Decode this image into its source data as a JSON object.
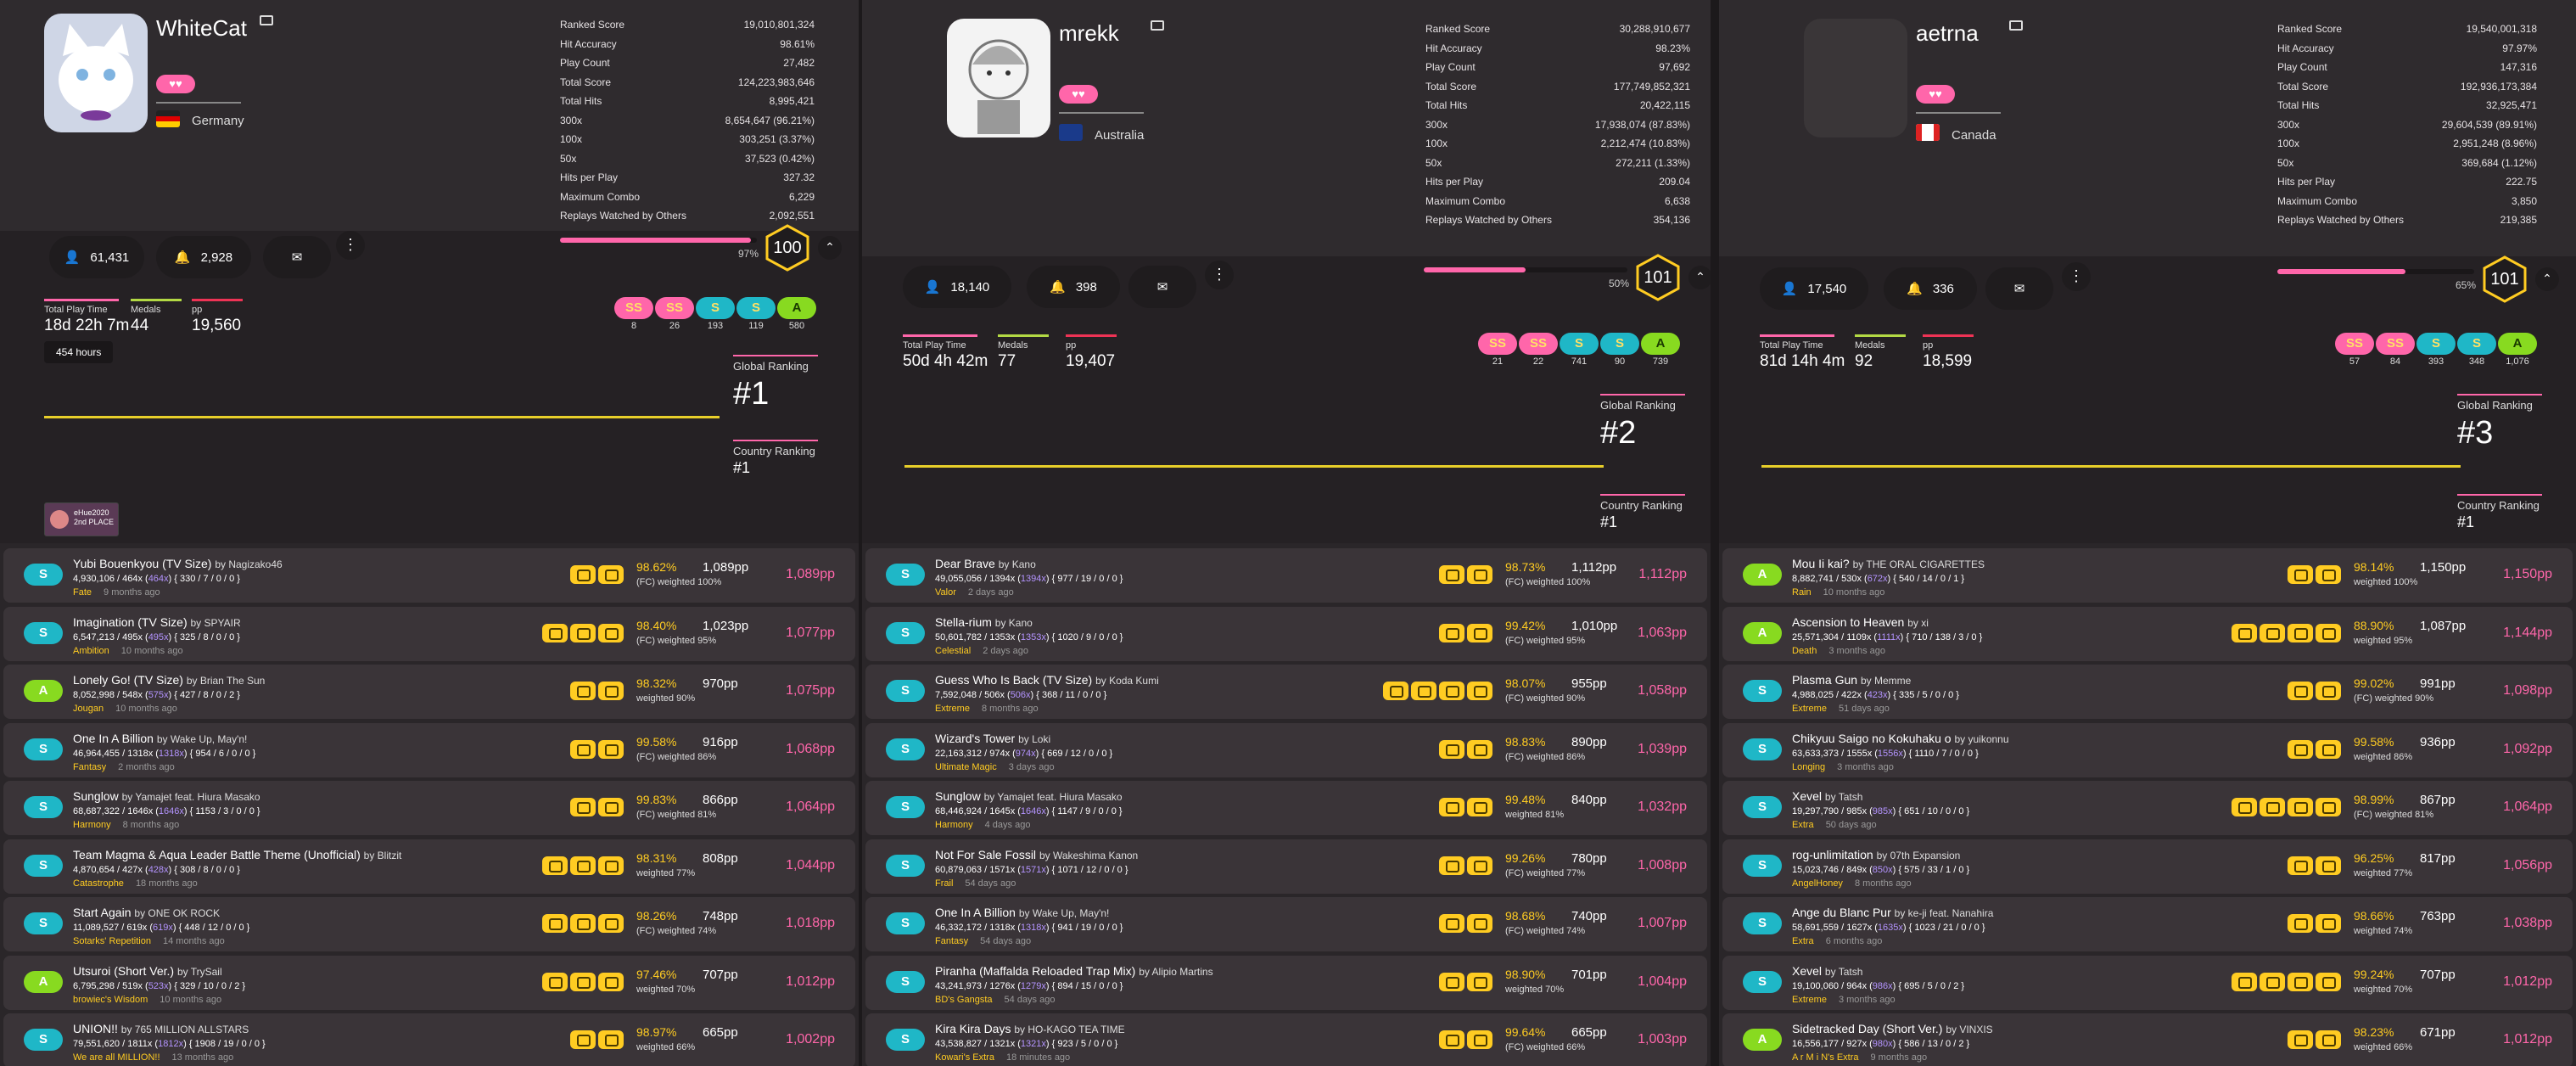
{
  "colors": {
    "pink": "#ff66aa",
    "gold": "#ffcc22",
    "purple_ext": "#b494ff",
    "ss_grade": "#ff66aa",
    "s_grade": "#1fb7c7",
    "a_grade": "#88da20"
  },
  "panels": [
    {
      "username": "WhiteCat",
      "country": "Germany",
      "stats": [
        {
          "label": "Ranked Score",
          "value": "19,010,801,324"
        },
        {
          "label": "Hit Accuracy",
          "value": "98.61%"
        },
        {
          "label": "Play Count",
          "value": "27,482"
        },
        {
          "label": "Total Score",
          "value": "124,223,983,646"
        },
        {
          "label": "Total Hits",
          "value": "8,995,421"
        },
        {
          "label": "300x",
          "value": "8,654,647 (96.21%)"
        },
        {
          "label": "100x",
          "value": "303,251 (3.37%)"
        },
        {
          "label": "50x",
          "value": "37,523 (0.42%)"
        },
        {
          "label": "Hits per Play",
          "value": "327.32"
        },
        {
          "label": "Maximum Combo",
          "value": "6,229"
        },
        {
          "label": "Replays Watched by Others",
          "value": "2,092,551"
        }
      ],
      "followers": "61,431",
      "subscribers": "2,928",
      "level_progress_label": "97%",
      "level_progress": 0.97,
      "level": "100",
      "play_time_label": "Total Play Time",
      "play_time": "18d 22h 7m",
      "medals_label": "Medals",
      "medals": "44",
      "pp_label": "pp",
      "pp": "19,560",
      "tooltip": "454 hours",
      "grades": [
        {
          "grade": "SS",
          "count": "8"
        },
        {
          "grade": "SS",
          "count": "26"
        },
        {
          "grade": "S",
          "count": "193"
        },
        {
          "grade": "S",
          "count": "119"
        },
        {
          "grade": "A",
          "count": "580"
        }
      ],
      "global_ranking_label": "Global Ranking",
      "global_rank": "#1",
      "country_ranking_label": "Country Ranking",
      "country_rank": "#1",
      "badge_text": "eHue2020 2nd PLACE",
      "plays": [
        {
          "rank": "S",
          "title": "Yubi Bouenkyou (TV Size)",
          "by": "by Nagizako46",
          "meta_a": "4,930,106 / 464x (",
          "meta_b": "464x",
          "meta_c": ") { 330 / 7 / 0 / 0 }",
          "diff": "Fate",
          "ago": "9 months ago",
          "mods": 2,
          "acc": "98.62%",
          "wpp": "1,089pp",
          "weight": "(FC) weighted 100%",
          "pp": "1,089pp"
        },
        {
          "rank": "S",
          "title": "Imagination (TV Size)",
          "by": "by SPYAIR",
          "meta_a": "6,547,213 / 495x (",
          "meta_b": "495x",
          "meta_c": ") { 325 / 8 / 0 / 0 }",
          "diff": "Ambition",
          "ago": "10 months ago",
          "mods": 3,
          "acc": "98.40%",
          "wpp": "1,023pp",
          "weight": "(FC) weighted 95%",
          "pp": "1,077pp"
        },
        {
          "rank": "A",
          "title": "Lonely Go! (TV Size)",
          "by": "by Brian The Sun",
          "meta_a": "8,052,998 / 548x (",
          "meta_b": "575x",
          "meta_c": ") { 427 / 8 / 0 / 2 }",
          "diff": "Jougan",
          "ago": "10 months ago",
          "mods": 2,
          "acc": "98.32%",
          "wpp": "970pp",
          "weight": "weighted 90%",
          "pp": "1,075pp"
        },
        {
          "rank": "S",
          "title": "One In A Billion",
          "by": "by Wake Up, May'n!",
          "meta_a": "46,964,455 / 1318x (",
          "meta_b": "1318x",
          "meta_c": ") { 954 / 6 / 0 / 0 }",
          "diff": "Fantasy",
          "ago": "2 months ago",
          "mods": 2,
          "acc": "99.58%",
          "wpp": "916pp",
          "weight": "(FC) weighted 86%",
          "pp": "1,068pp"
        },
        {
          "rank": "S",
          "title": "Sunglow",
          "by": "by Yamajet feat. Hiura Masako",
          "meta_a": "68,687,322 / 1646x (",
          "meta_b": "1646x",
          "meta_c": ") { 1153 / 3 / 0 / 0 }",
          "diff": "Harmony",
          "ago": "8 months ago",
          "mods": 2,
          "acc": "99.83%",
          "wpp": "866pp",
          "weight": "(FC) weighted 81%",
          "pp": "1,064pp"
        },
        {
          "rank": "S",
          "title": "Team Magma & Aqua Leader Battle Theme (Unofficial)",
          "by": "by Blitzit",
          "meta_a": "4,870,654 / 427x (",
          "meta_b": "428x",
          "meta_c": ") { 308 / 8 / 0 / 0 }",
          "diff": "Catastrophe",
          "ago": "18 months ago",
          "mods": 3,
          "acc": "98.31%",
          "wpp": "808pp",
          "weight": "weighted 77%",
          "pp": "1,044pp"
        },
        {
          "rank": "S",
          "title": "Start Again",
          "by": "by ONE OK ROCK",
          "meta_a": "11,089,527 / 619x (",
          "meta_b": "619x",
          "meta_c": ") { 448 / 12 / 0 / 0 }",
          "diff": "Sotarks' Repetition",
          "ago": "14 months ago",
          "mods": 3,
          "acc": "98.26%",
          "wpp": "748pp",
          "weight": "(FC) weighted 74%",
          "pp": "1,018pp"
        },
        {
          "rank": "A",
          "title": "Utsuroi (Short Ver.)",
          "by": "by TrySail",
          "meta_a": "6,795,298 / 519x (",
          "meta_b": "523x",
          "meta_c": ") { 329 / 10 / 0 / 2 }",
          "diff": "browiec's Wisdom",
          "ago": "10 months ago",
          "mods": 3,
          "acc": "97.46%",
          "wpp": "707pp",
          "weight": "weighted 70%",
          "pp": "1,012pp"
        },
        {
          "rank": "S",
          "title": "UNION!!",
          "by": "by 765 MILLION ALLSTARS",
          "meta_a": "79,551,620 / 1811x (",
          "meta_b": "1812x",
          "meta_c": ") { 1908 / 19 / 0 / 0 }",
          "diff": "We are all MILLION!!",
          "ago": "13 months ago",
          "mods": 2,
          "acc": "98.97%",
          "wpp": "665pp",
          "weight": "weighted 66%",
          "pp": "1,002pp"
        }
      ]
    },
    {
      "username": "mrekk",
      "country": "Australia",
      "stats": [
        {
          "label": "Ranked Score",
          "value": "30,288,910,677"
        },
        {
          "label": "Hit Accuracy",
          "value": "98.23%"
        },
        {
          "label": "Play Count",
          "value": "97,692"
        },
        {
          "label": "Total Score",
          "value": "177,749,852,321"
        },
        {
          "label": "Total Hits",
          "value": "20,422,115"
        },
        {
          "label": "300x",
          "value": "17,938,074 (87.83%)"
        },
        {
          "label": "100x",
          "value": "2,212,474 (10.83%)"
        },
        {
          "label": "50x",
          "value": "272,211 (1.33%)"
        },
        {
          "label": "Hits per Play",
          "value": "209.04"
        },
        {
          "label": "Maximum Combo",
          "value": "6,638"
        },
        {
          "label": "Replays Watched by Others",
          "value": "354,136"
        }
      ],
      "followers": "18,140",
      "subscribers": "398",
      "level_progress_label": "50%",
      "level_progress": 0.5,
      "level": "101",
      "play_time_label": "Total Play Time",
      "play_time": "50d 4h 42m",
      "medals_label": "Medals",
      "medals": "77",
      "pp_label": "pp",
      "pp": "19,407",
      "grades": [
        {
          "grade": "SS",
          "count": "21"
        },
        {
          "grade": "SS",
          "count": "22"
        },
        {
          "grade": "S",
          "count": "741"
        },
        {
          "grade": "S",
          "count": "90"
        },
        {
          "grade": "A",
          "count": "739"
        }
      ],
      "global_ranking_label": "Global Ranking",
      "global_rank": "#2",
      "country_ranking_label": "Country Ranking",
      "country_rank": "#1",
      "plays": [
        {
          "rank": "S",
          "title": "Dear Brave",
          "by": "by Kano",
          "meta_a": "49,055,056 / 1394x (",
          "meta_b": "1394x",
          "meta_c": ") { 977 / 19 / 0 / 0 }",
          "diff": "Valor",
          "ago": "2 days ago",
          "mods": 2,
          "acc": "98.73%",
          "wpp": "1,112pp",
          "weight": "(FC) weighted 100%",
          "pp": "1,112pp"
        },
        {
          "rank": "S",
          "title": "Stella-rium",
          "by": "by Kano",
          "meta_a": "50,601,782 / 1353x (",
          "meta_b": "1353x",
          "meta_c": ") { 1020 / 9 / 0 / 0 }",
          "diff": "Celestial",
          "ago": "2 days ago",
          "mods": 2,
          "acc": "99.42%",
          "wpp": "1,010pp",
          "weight": "(FC) weighted 95%",
          "pp": "1,063pp"
        },
        {
          "rank": "S",
          "title": "Guess Who Is Back (TV Size)",
          "by": "by Koda Kumi",
          "meta_a": "7,592,048 / 506x (",
          "meta_b": "506x",
          "meta_c": ") { 368 / 11 / 0 / 0 }",
          "diff": "Extreme",
          "ago": "8 months ago",
          "mods": 4,
          "acc": "98.07%",
          "wpp": "955pp",
          "weight": "(FC) weighted 90%",
          "pp": "1,058pp"
        },
        {
          "rank": "S",
          "title": "Wizard's Tower",
          "by": "by Loki",
          "meta_a": "22,163,312 / 974x (",
          "meta_b": "974x",
          "meta_c": ") { 669 / 12 / 0 / 0 }",
          "diff": "Ultimate Magic",
          "ago": "3 days ago",
          "mods": 2,
          "acc": "98.83%",
          "wpp": "890pp",
          "weight": "(FC) weighted 86%",
          "pp": "1,039pp"
        },
        {
          "rank": "S",
          "title": "Sunglow",
          "by": "by Yamajet feat. Hiura Masako",
          "meta_a": "68,446,924 / 1645x (",
          "meta_b": "1646x",
          "meta_c": ") { 1147 / 9 / 0 / 0 }",
          "diff": "Harmony",
          "ago": "4 days ago",
          "mods": 2,
          "acc": "99.48%",
          "wpp": "840pp",
          "weight": "weighted 81%",
          "pp": "1,032pp"
        },
        {
          "rank": "S",
          "title": "Not For Sale Fossil",
          "by": "by Wakeshima Kanon",
          "meta_a": "60,879,063 / 1571x (",
          "meta_b": "1571x",
          "meta_c": ") { 1071 / 12 / 0 / 0 }",
          "diff": "Frail",
          "ago": "54 days ago",
          "mods": 2,
          "acc": "99.26%",
          "wpp": "780pp",
          "weight": "(FC) weighted 77%",
          "pp": "1,008pp"
        },
        {
          "rank": "S",
          "title": "One In A Billion",
          "by": "by Wake Up, May'n!",
          "meta_a": "46,332,172 / 1318x (",
          "meta_b": "1318x",
          "meta_c": ") { 941 / 19 / 0 / 0 }",
          "diff": "Fantasy",
          "ago": "54 days ago",
          "mods": 2,
          "acc": "98.68%",
          "wpp": "740pp",
          "weight": "(FC) weighted 74%",
          "pp": "1,007pp"
        },
        {
          "rank": "S",
          "title": "Piranha (Maffalda Reloaded Trap Mix)",
          "by": "by Alipio Martins",
          "meta_a": "43,241,973 / 1276x (",
          "meta_b": "1279x",
          "meta_c": ") { 894 / 15 / 0 / 0 }",
          "diff": "BD's Gangsta",
          "ago": "54 days ago",
          "mods": 2,
          "acc": "98.90%",
          "wpp": "701pp",
          "weight": "weighted 70%",
          "pp": "1,004pp"
        },
        {
          "rank": "S",
          "title": "Kira Kira Days",
          "by": "by HO-KAGO TEA TIME",
          "meta_a": "43,538,827 / 1321x (",
          "meta_b": "1321x",
          "meta_c": ") { 923 / 5 / 0 / 0 }",
          "diff": "Kowari's Extra",
          "ago": "18 minutes ago",
          "mods": 2,
          "acc": "99.64%",
          "wpp": "665pp",
          "weight": "(FC) weighted 66%",
          "pp": "1,003pp"
        }
      ]
    },
    {
      "username": "aetrna",
      "country": "Canada",
      "stats": [
        {
          "label": "Ranked Score",
          "value": "19,540,001,318"
        },
        {
          "label": "Hit Accuracy",
          "value": "97.97%"
        },
        {
          "label": "Play Count",
          "value": "147,316"
        },
        {
          "label": "Total Score",
          "value": "192,936,173,384"
        },
        {
          "label": "Total Hits",
          "value": "32,925,471"
        },
        {
          "label": "300x",
          "value": "29,604,539 (89.91%)"
        },
        {
          "label": "100x",
          "value": "2,951,248 (8.96%)"
        },
        {
          "label": "50x",
          "value": "369,684 (1.12%)"
        },
        {
          "label": "Hits per Play",
          "value": "222.75"
        },
        {
          "label": "Maximum Combo",
          "value": "3,850"
        },
        {
          "label": "Replays Watched by Others",
          "value": "219,385"
        }
      ],
      "followers": "17,540",
      "subscribers": "336",
      "level_progress_label": "65%",
      "level_progress": 0.65,
      "level": "101",
      "play_time_label": "Total Play Time",
      "play_time": "81d 14h 4m",
      "medals_label": "Medals",
      "medals": "92",
      "pp_label": "pp",
      "pp": "18,599",
      "grades": [
        {
          "grade": "SS",
          "count": "57"
        },
        {
          "grade": "SS",
          "count": "84"
        },
        {
          "grade": "S",
          "count": "393"
        },
        {
          "grade": "S",
          "count": "348"
        },
        {
          "grade": "A",
          "count": "1,076"
        }
      ],
      "global_ranking_label": "Global Ranking",
      "global_rank": "#3",
      "country_ranking_label": "Country Ranking",
      "country_rank": "#1",
      "plays": [
        {
          "rank": "A",
          "title": "Mou Ii kai?",
          "by": "by THE ORAL CIGARETTES",
          "meta_a": "8,882,741 / 530x (",
          "meta_b": "672x",
          "meta_c": ") { 540 / 14 / 0 / 1 }",
          "diff": "Rain",
          "ago": "10 months ago",
          "mods": 2,
          "acc": "98.14%",
          "wpp": "1,150pp",
          "weight": "weighted 100%",
          "pp": "1,150pp"
        },
        {
          "rank": "A",
          "title": "Ascension to Heaven",
          "by": "by xi",
          "meta_a": "25,571,304 / 1109x (",
          "meta_b": "1111x",
          "meta_c": ") { 710 / 138 / 3 / 0 }",
          "diff": "Death",
          "ago": "3 months ago",
          "mods": 4,
          "acc": "88.90%",
          "wpp": "1,087pp",
          "weight": "weighted 95%",
          "pp": "1,144pp"
        },
        {
          "rank": "S",
          "title": "Plasma Gun",
          "by": "by Memme",
          "meta_a": "4,988,025 / 422x (",
          "meta_b": "423x",
          "meta_c": ") { 335 / 5 / 0 / 0 }",
          "diff": "Extreme",
          "ago": "51 days ago",
          "mods": 2,
          "acc": "99.02%",
          "wpp": "991pp",
          "weight": "(FC) weighted 90%",
          "pp": "1,098pp"
        },
        {
          "rank": "S",
          "title": "Chikyuu Saigo no Kokuhaku o",
          "by": "by yuikonnu",
          "meta_a": "63,633,373 / 1555x (",
          "meta_b": "1556x",
          "meta_c": ") { 1110 / 7 / 0 / 0 }",
          "diff": "Longing",
          "ago": "3 months ago",
          "mods": 2,
          "acc": "99.58%",
          "wpp": "936pp",
          "weight": "weighted 86%",
          "pp": "1,092pp"
        },
        {
          "rank": "S",
          "title": "Xevel",
          "by": "by Tatsh",
          "meta_a": "19,297,790 / 985x (",
          "meta_b": "985x",
          "meta_c": ") { 651 / 10 / 0 / 0 }",
          "diff": "Extra",
          "ago": "50 days ago",
          "mods": 4,
          "acc": "98.99%",
          "wpp": "867pp",
          "weight": "(FC) weighted 81%",
          "pp": "1,064pp"
        },
        {
          "rank": "S",
          "title": "rog-unlimitation",
          "by": "by 07th Expansion",
          "meta_a": "15,023,746 / 849x (",
          "meta_b": "850x",
          "meta_c": ") { 575 / 33 / 1 / 0 }",
          "diff": "AngelHoney",
          "ago": "8 months ago",
          "mods": 2,
          "acc": "96.25%",
          "wpp": "817pp",
          "weight": "weighted 77%",
          "pp": "1,056pp"
        },
        {
          "rank": "S",
          "title": "Ange du Blanc Pur",
          "by": "by ke-ji feat. Nanahira",
          "meta_a": "58,691,559 / 1627x (",
          "meta_b": "1635x",
          "meta_c": ") { 1023 / 21 / 0 / 0 }",
          "diff": "Extra",
          "ago": "6 months ago",
          "mods": 2,
          "acc": "98.66%",
          "wpp": "763pp",
          "weight": "weighted 74%",
          "pp": "1,038pp"
        },
        {
          "rank": "S",
          "title": "Xevel",
          "by": "by Tatsh",
          "meta_a": "19,100,060 / 964x (",
          "meta_b": "986x",
          "meta_c": ") { 695 / 5 / 0 / 2 }",
          "diff": "Extreme",
          "ago": "3 months ago",
          "mods": 4,
          "acc": "99.24%",
          "wpp": "707pp",
          "weight": "weighted 70%",
          "pp": "1,012pp"
        },
        {
          "rank": "A",
          "title": "Sidetracked Day (Short Ver.)",
          "by": "by VINXIS",
          "meta_a": "16,556,177 / 927x (",
          "meta_b": "980x",
          "meta_c": ") { 586 / 13 / 0 / 2 }",
          "diff": "A r M i N's Extra",
          "ago": "9 months ago",
          "mods": 2,
          "acc": "98.23%",
          "wpp": "671pp",
          "weight": "weighted 66%",
          "pp": "1,012pp"
        }
      ]
    }
  ]
}
